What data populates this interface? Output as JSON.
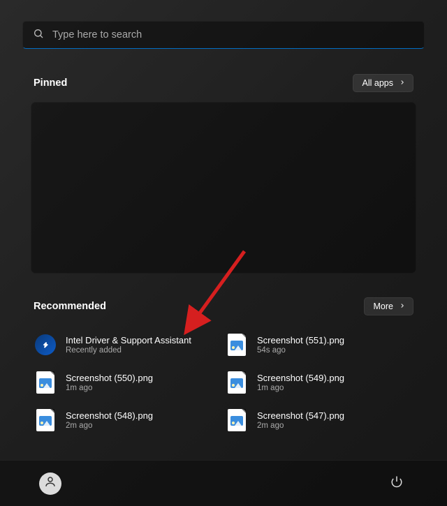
{
  "search": {
    "placeholder": "Type here to search"
  },
  "pinned": {
    "title": "Pinned",
    "button": "All apps"
  },
  "recommended": {
    "title": "Recommended",
    "button": "More",
    "items": [
      {
        "title": "Intel Driver & Support Assistant",
        "sub": "Recently added",
        "icon": "intel"
      },
      {
        "title": "Screenshot (551).png",
        "sub": "54s ago",
        "icon": "image"
      },
      {
        "title": "Screenshot (550).png",
        "sub": "1m ago",
        "icon": "image"
      },
      {
        "title": "Screenshot (549).png",
        "sub": "1m ago",
        "icon": "image"
      },
      {
        "title": "Screenshot (548).png",
        "sub": "2m ago",
        "icon": "image"
      },
      {
        "title": "Screenshot (547).png",
        "sub": "2m ago",
        "icon": "image"
      }
    ]
  },
  "annotation": {
    "arrow_color": "#d61f1f"
  }
}
